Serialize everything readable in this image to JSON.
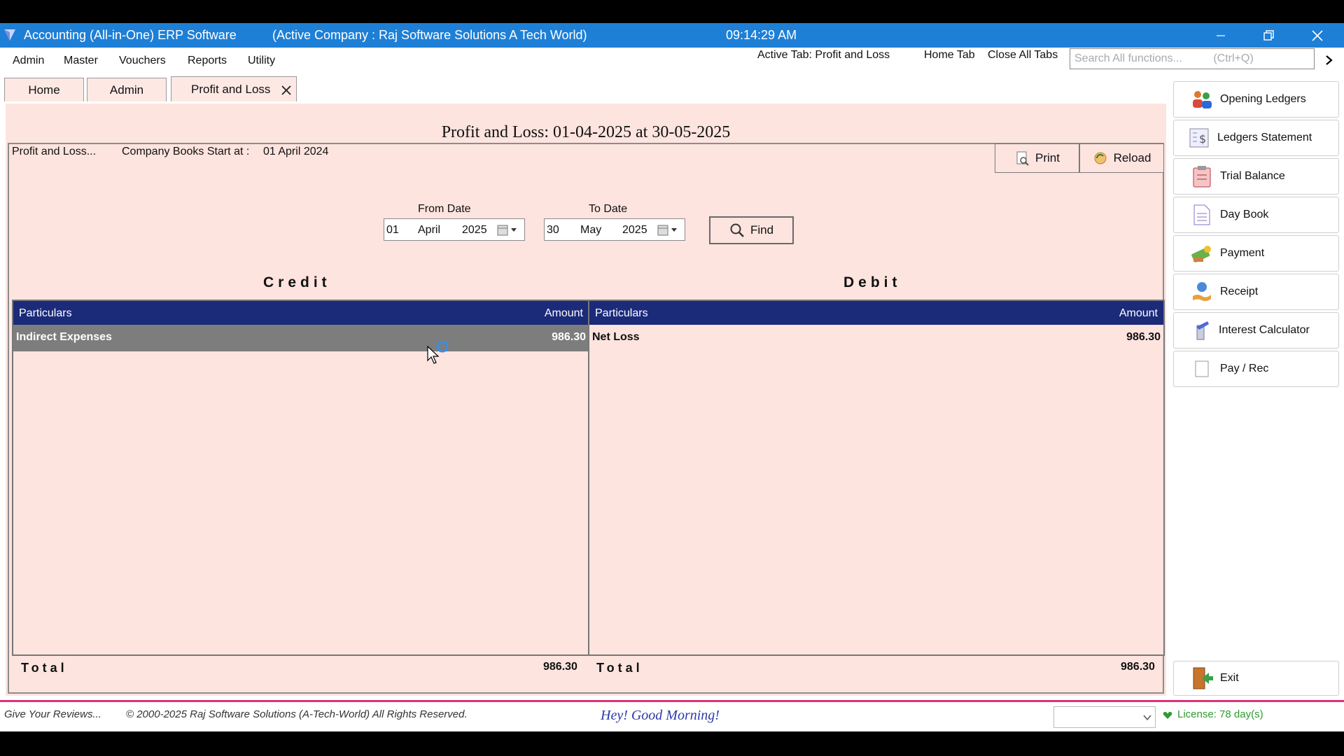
{
  "titlebar": {
    "app_title": "Accounting (All-in-One) ERP Software",
    "active_company": "(Active Company :  Raj Software Solutions A Tech World)",
    "clock": "09:14:29 AM"
  },
  "menu": [
    "Admin",
    "Master",
    "Vouchers",
    "Reports",
    "Utility"
  ],
  "topbar": {
    "active_tab_label": "Active Tab: Profit and Loss",
    "home_tab": "Home Tab",
    "close_all_tabs": "Close All Tabs",
    "search_placeholder": "Search All functions...          (Ctrl+Q)"
  },
  "tabs": [
    {
      "label": "Home"
    },
    {
      "label": "Admin"
    },
    {
      "label": "Profit and Loss",
      "active": true
    }
  ],
  "report": {
    "heading": "Profit and Loss: 01-04-2025 at 30-05-2025",
    "caption": "Profit and Loss...",
    "books_start_label": "Company Books Start at :",
    "books_start_value": "01 April 2024",
    "print_label": "Print",
    "reload_label": "Reload",
    "from_date": {
      "label": "From Date",
      "day": "01",
      "month": "April",
      "year": "2025"
    },
    "to_date": {
      "label": "To Date",
      "day": "30",
      "month": "May",
      "year": "2025"
    },
    "find_label": "Find"
  },
  "credit": {
    "title": "Credit",
    "col_particulars": "Particulars",
    "col_amount": "Amount",
    "rows": [
      {
        "particulars": "Indirect Expenses",
        "amount": "986.30"
      }
    ],
    "total_label": "Total",
    "total_value": "986.30"
  },
  "debit": {
    "title": "Debit",
    "col_particulars": "Particulars",
    "col_amount": "Amount",
    "rows": [
      {
        "particulars": "Net Loss",
        "amount": "986.30"
      }
    ],
    "total_label": "Total",
    "total_value": "986.30"
  },
  "sidebar": [
    {
      "label": "Opening Ledgers",
      "icon": "people-icon"
    },
    {
      "label": "Ledgers Statement",
      "icon": "statement-icon"
    },
    {
      "label": "Trial Balance",
      "icon": "clipboard-icon"
    },
    {
      "label": "Day Book",
      "icon": "document-icon"
    },
    {
      "label": "Payment",
      "icon": "money-icon"
    },
    {
      "label": "Receipt",
      "icon": "receipt-icon"
    },
    {
      "label": "Interest Calculator",
      "icon": "calculator-icon"
    },
    {
      "label": "Pay / Rec",
      "icon": "page-icon"
    }
  ],
  "exit_label": "Exit",
  "status": {
    "reviews": "Give Your Reviews...",
    "copyright": "© 2000-2025 Raj Software Solutions (A-Tech-World) All Rights Reserved.",
    "greeting": "Hey! Good Morning!",
    "license": "License: 78 day(s)"
  },
  "colors": {
    "titlebar": "#1e7fd6",
    "grid_header": "#1c2a7a",
    "panel_bg": "#fde4df",
    "selected_row": "#7d7d7d",
    "status_accent": "#e0307a",
    "license_green": "#2e9b2e"
  }
}
